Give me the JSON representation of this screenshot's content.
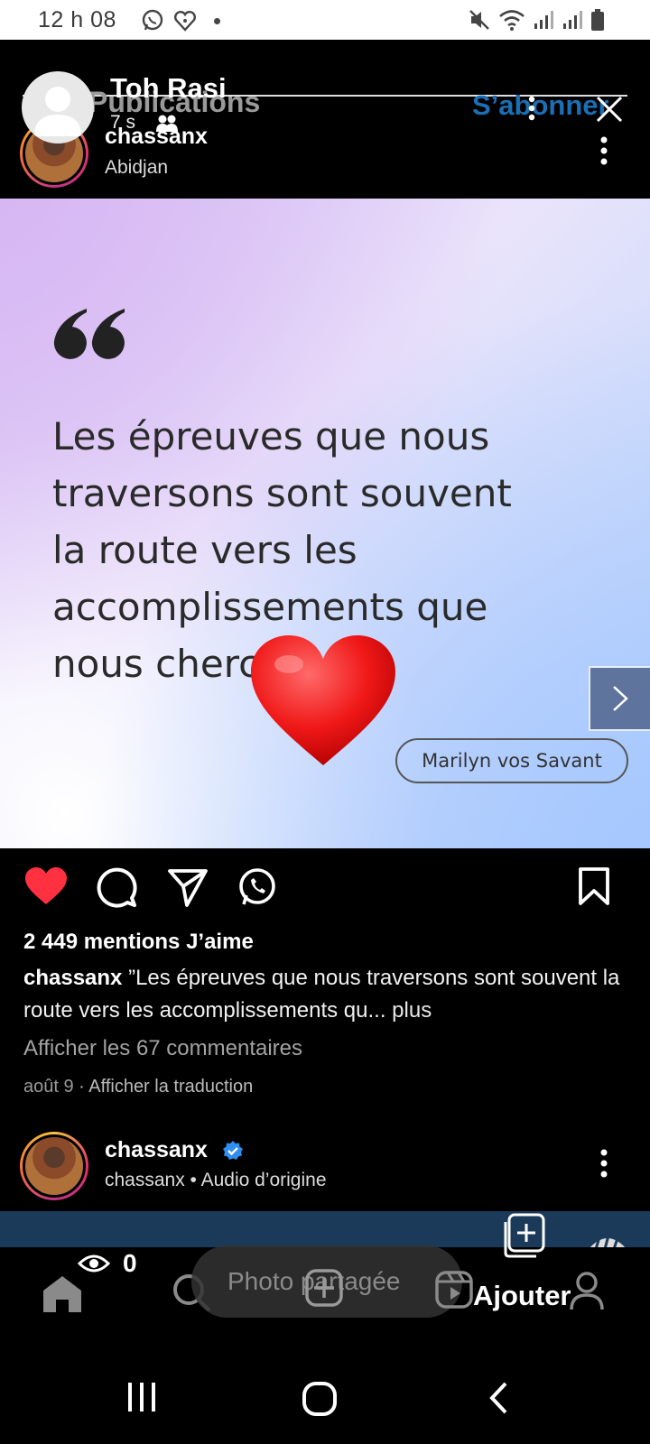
{
  "status_bar": {
    "time": "12 h 08"
  },
  "instagram_header": {
    "title": "Publications",
    "subscribe_label": "S’abonner"
  },
  "post": {
    "username": "chassanx",
    "location": "Abidjan",
    "quote_lines": [
      "Les épreuves que nous",
      "traversons sont souvent",
      "la route vers les",
      "accomplissements que",
      "nous chercho"
    ],
    "quote_author": "Marilyn vos Savant",
    "likes": "2 449 mentions J’aime",
    "caption_user": "chassanx",
    "caption_text": " ”Les épreuves que nous traversons sont souvent la route vers les accomplissements qu...",
    "caption_more": " plus",
    "view_comments": "Afficher les 67 commentaires",
    "date": "août 9",
    "translate": " · Afficher la traduction"
  },
  "story": {
    "name": "Toh Rasi",
    "time": "7 s",
    "views": "0",
    "reply_placeholder": "Photo partagée",
    "add_label": "Ajouter"
  },
  "next_post": {
    "username": "chassanx",
    "subtitle": "chassanx • Audio d’origine"
  },
  "colors": {
    "subscribe": "#1a6fb5",
    "like_red": "#ff3040",
    "verified": "#2f8ef0",
    "strip": "#1b3a5a"
  }
}
